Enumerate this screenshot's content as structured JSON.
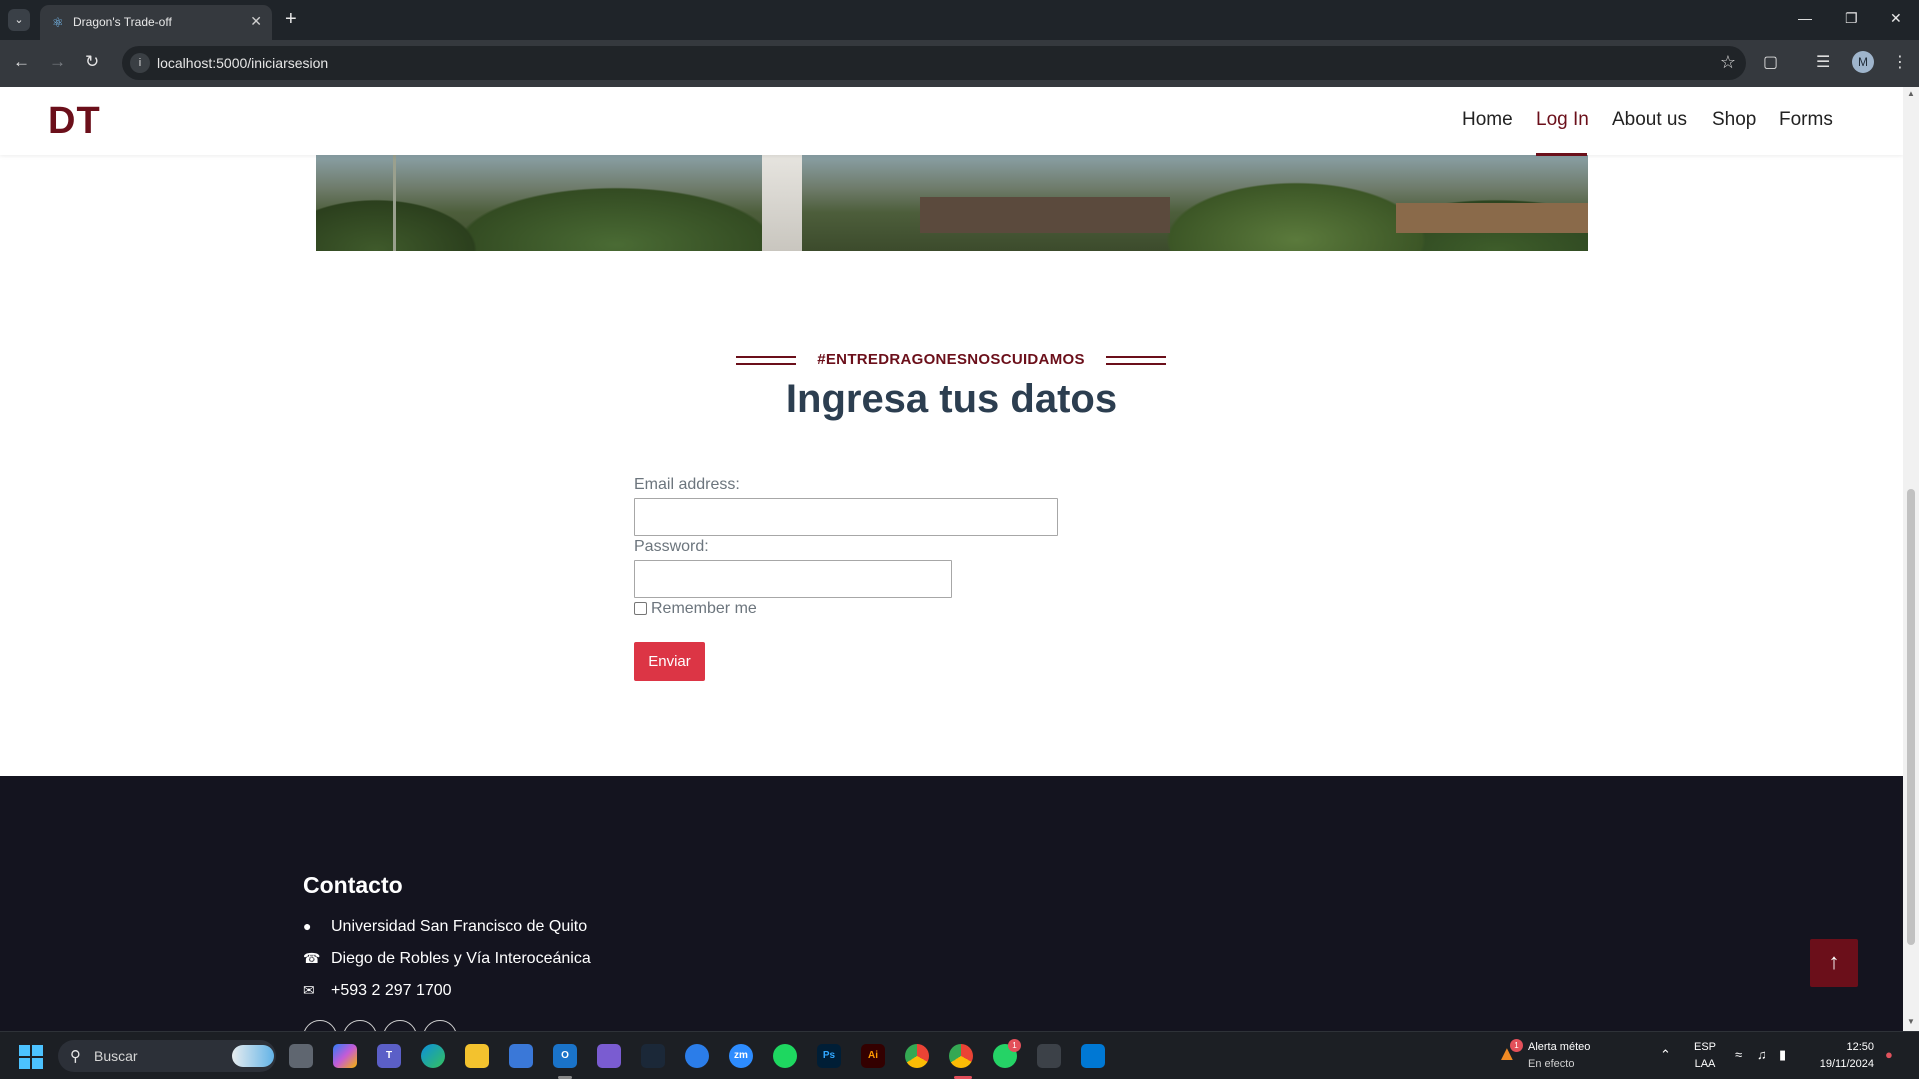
{
  "browser": {
    "tab_title": "Dragon's Trade-off",
    "url": "localhost:5000/iniciarsesion",
    "profile_initial": "M"
  },
  "site": {
    "logo": "DT",
    "nav": [
      {
        "label": "Home"
      },
      {
        "label": "Log In",
        "active": true
      },
      {
        "label": "About us"
      },
      {
        "label": "Shop"
      },
      {
        "label": "Forms"
      }
    ]
  },
  "login": {
    "eyebrow": "#ENTREDRAGONESNOSCUIDAMOS",
    "title": "Ingresa tus datos",
    "email_label": "Email address:",
    "email_value": "",
    "password_label": "Password:",
    "password_value": "",
    "remember_label": "Remember me",
    "remember_checked": false,
    "submit_label": "Enviar"
  },
  "footer": {
    "title": "Contacto",
    "contacts": [
      {
        "icon": "map-marker-icon",
        "text": "Universidad San Francisco de Quito"
      },
      {
        "icon": "phone-icon",
        "text": "Diego de Robles y Vía Interoceánica"
      },
      {
        "icon": "envelope-icon",
        "text": "+593 2 297 1700"
      }
    ],
    "social_icons": [
      "twitter-icon",
      "facebook-icon",
      "youtube-icon",
      "linkedin-icon"
    ]
  },
  "taskbar": {
    "search_placeholder": "Buscar",
    "weather_title": "Alerta méteo",
    "weather_subtitle": "En efecto",
    "weather_badge": "1",
    "whatsapp_badge": "1",
    "language": "ESP",
    "keyboard": "LAA",
    "time": "12:50",
    "date": "19/11/2024"
  },
  "colors": {
    "brand": "#6b0f1a",
    "button": "#dc3545",
    "title": "#2c3e50",
    "footer_bg": "#14141f"
  }
}
